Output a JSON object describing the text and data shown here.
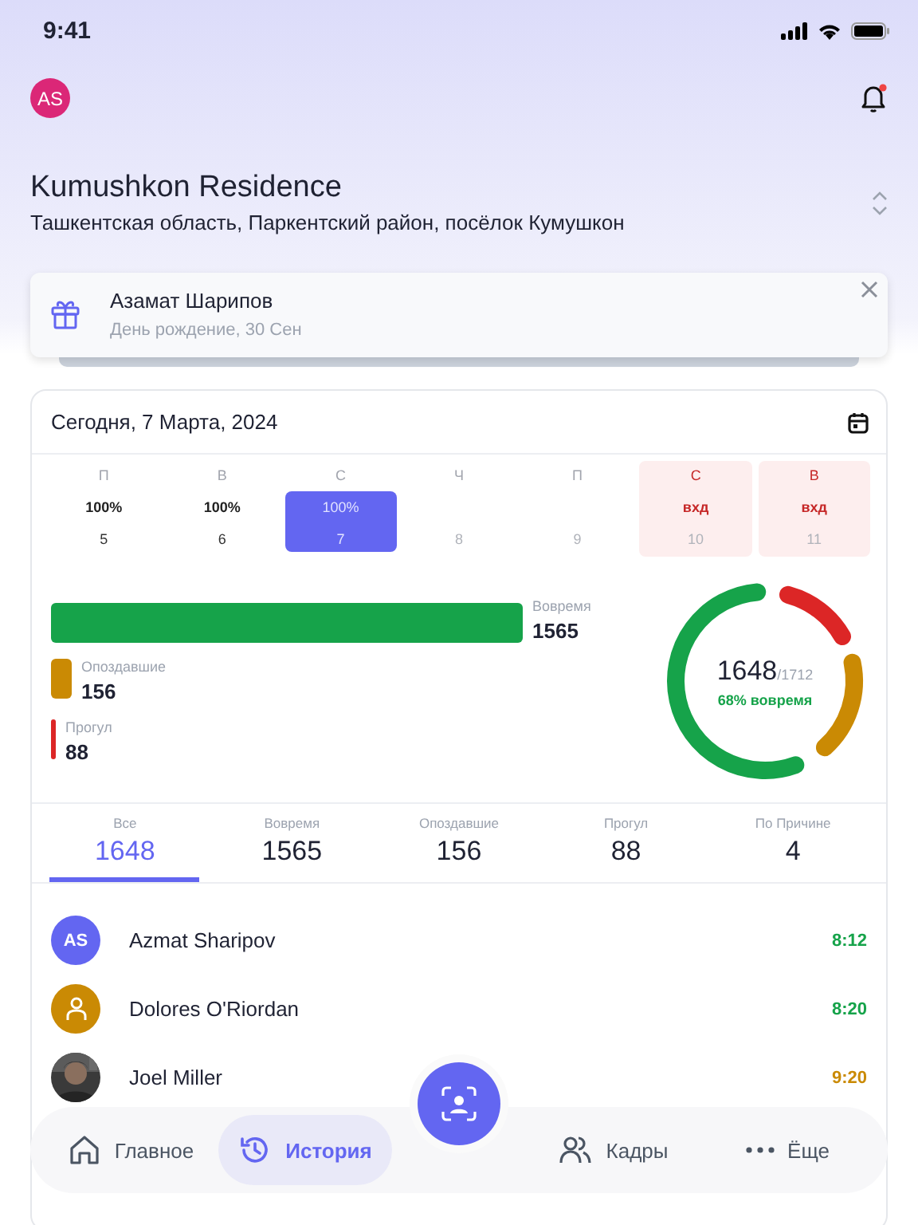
{
  "status_bar": {
    "time": "9:41"
  },
  "header": {
    "avatar_initials": "AS",
    "notification_unread": true
  },
  "location": {
    "title": "Kumushkon Residence",
    "address": "Ташкентская область, Паркентский район, посёлок Кумушкон"
  },
  "birthday": {
    "name": "Азамат Шарипов",
    "detail": "День рождение, 30 Сен"
  },
  "date_title": "Сегодня, 7 Марта, 2024",
  "week": [
    {
      "weekday": "П",
      "value": "100%",
      "date": "5",
      "kind": "workday",
      "selected": false,
      "disabled": false
    },
    {
      "weekday": "В",
      "value": "100%",
      "date": "6",
      "kind": "workday",
      "selected": false,
      "disabled": false
    },
    {
      "weekday": "С",
      "value": "100%",
      "date": "7",
      "kind": "workday",
      "selected": true,
      "disabled": false
    },
    {
      "weekday": "Ч",
      "date": "8",
      "kind": "workday",
      "selected": false,
      "disabled": true
    },
    {
      "weekday": "П",
      "date": "9",
      "kind": "workday",
      "selected": false,
      "disabled": true
    },
    {
      "weekday": "С",
      "value": "вхд",
      "date": "10",
      "kind": "weekend",
      "selected": false,
      "disabled": true
    },
    {
      "weekday": "В",
      "value": "вхд",
      "date": "11",
      "kind": "weekend",
      "selected": false,
      "disabled": true
    }
  ],
  "bars": [
    {
      "label": "Вовремя",
      "value": "1565",
      "color": "#16a34a"
    },
    {
      "label": "Опоздавшие",
      "value": "156",
      "color": "#ca8a04"
    },
    {
      "label": "Прогул",
      "value": "88",
      "color": "#dc2626"
    }
  ],
  "donut": {
    "count": "1648",
    "total": "/1712",
    "caption": "68% вовремя"
  },
  "tabs": [
    {
      "label": "Все",
      "count": "1648",
      "selected": true
    },
    {
      "label": "Вовремя",
      "count": "1565",
      "selected": false
    },
    {
      "label": "Опоздавшие",
      "count": "156",
      "selected": false
    },
    {
      "label": "Прогул",
      "count": "88",
      "selected": false
    },
    {
      "label": "По Причине",
      "count": "4",
      "selected": false
    }
  ],
  "people": [
    {
      "avatar": {
        "kind": "initials",
        "initials": "AS",
        "color": "#6366f1"
      },
      "name": "Azmat Sharipov",
      "time": "8:12",
      "color": "#16a34a"
    },
    {
      "avatar": {
        "kind": "icon",
        "color": "#ca8a04"
      },
      "name": "Dolores O'Riordan",
      "time": "8:20",
      "color": "#16a34a"
    },
    {
      "name": "Joel Miller",
      "time": "9:20",
      "color": "#ca8a04"
    }
  ],
  "nav": [
    {
      "label": "Главное",
      "selected": false
    },
    {
      "label": "История",
      "selected": true
    },
    {
      "label": "Кадры",
      "selected": false
    },
    {
      "label": "Ёще",
      "selected": false
    }
  ]
}
